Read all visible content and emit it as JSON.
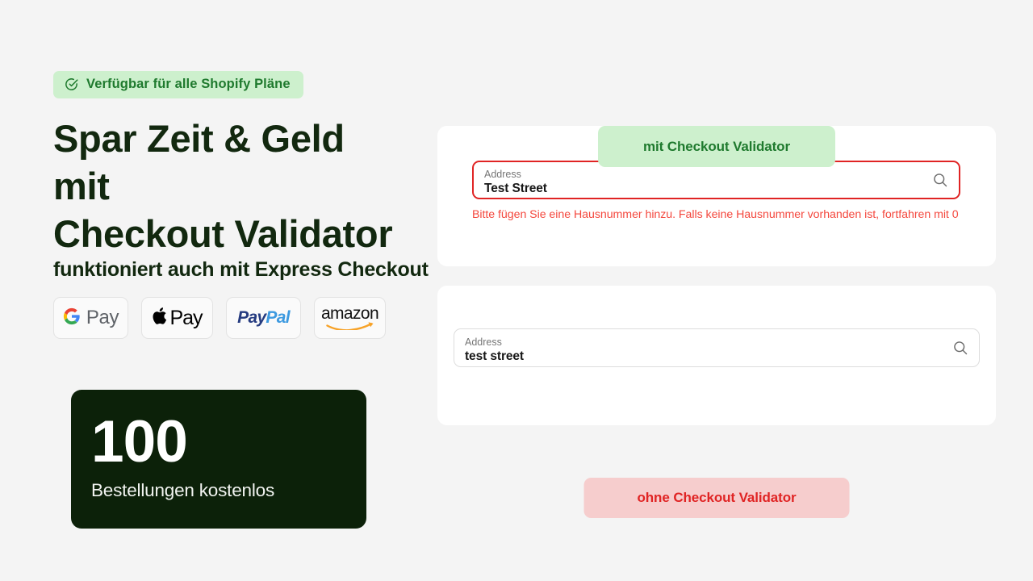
{
  "background_color": "#f4f4f4",
  "hero": {
    "availability_badge": {
      "icon": "check-circle-icon",
      "label": "Verfügbar für alle Shopify Pläne",
      "bg_color": "#cdf0cd",
      "text_color": "#1f7a2e"
    },
    "headline": "Spar Zeit & Geld mit\nCheckout Validator",
    "headline_color": "#12280f",
    "express_title": "funktioniert auch mit Express Checkout",
    "payment_methods": [
      {
        "id": "google-pay",
        "brand": "G",
        "label": "Pay"
      },
      {
        "id": "apple-pay",
        "brand": "",
        "label": "Pay"
      },
      {
        "id": "paypal",
        "brand": "Pay",
        "label": "Pal"
      },
      {
        "id": "amazon-pay",
        "brand": "",
        "label": "amazon"
      }
    ],
    "stat_card": {
      "number": "100",
      "label": "Bestellungen kostenlos",
      "bg_color": "#0c2109",
      "text_color": "#ffffff"
    }
  },
  "demos": [
    {
      "id": "with-validator",
      "badge_label": "mit Checkout Validator",
      "badge_bg": "#cdf0cd",
      "badge_text_color": "#1f7a2e",
      "field": {
        "label": "Address",
        "value": "Test Street",
        "placeholder": "Address",
        "state": "error",
        "icon": "search-icon"
      },
      "error_message": "Bitte fügen Sie eine Hausnummer hinzu. Falls keine Hausnummer vorhanden ist, fortfahren mit 0",
      "error_color": "#f4483e"
    },
    {
      "id": "without-validator",
      "badge_label": "ohne Checkout Validator",
      "badge_bg": "#f6cdcd",
      "badge_text_color": "#e02424",
      "field": {
        "label": "Address",
        "value": "test street",
        "placeholder": "Address",
        "state": "normal",
        "icon": "search-icon"
      },
      "error_message": "",
      "error_color": "#f4483e"
    }
  ]
}
